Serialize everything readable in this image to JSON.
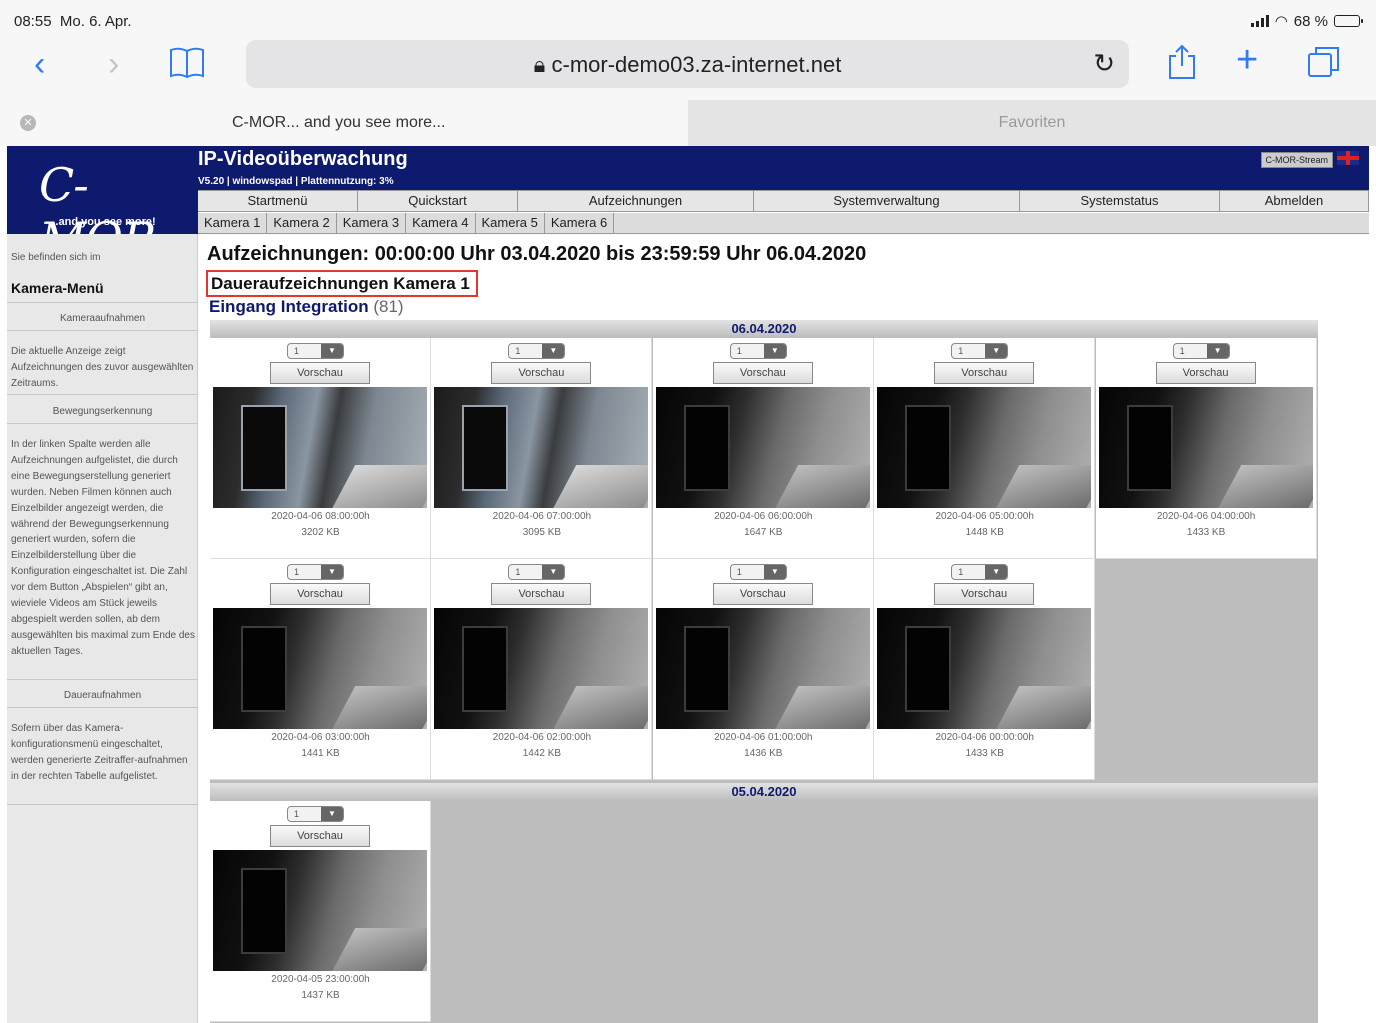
{
  "status": {
    "time": "08:55",
    "date": "Mo. 6. Apr.",
    "battery": "68 %",
    "battery_level": 0.68
  },
  "browser": {
    "url": "c-mor-demo03.za-internet.net",
    "tab_active": "C-MOR... and you see more...",
    "tab_favorites": "Favoriten"
  },
  "logo": {
    "name": "C-MOR",
    "tagline": "...and you see more!"
  },
  "header": {
    "title": "IP-Videoüberwachung",
    "version": "V5.20 | windowspad | Plattennutzung: 3%",
    "stream_button": "C-MOR-Stream"
  },
  "nav": {
    "main": [
      "Startmenü",
      "Quickstart",
      "Aufzeichnungen",
      "Systemverwaltung",
      "Systemstatus",
      "Abmelden"
    ],
    "cameras": [
      "Kamera 1",
      "Kamera 2",
      "Kamera 3",
      "Kamera 4",
      "Kamera 5",
      "Kamera 6"
    ]
  },
  "sidebar": {
    "location": "Sie befinden sich im",
    "menu_title": "Kamera-Menü",
    "sections": [
      {
        "title": "Kameraaufnahmen",
        "text": "Die aktuelle Anzeige zeigt Aufzeichnungen des zuvor ausgewählten Zeitraums."
      },
      {
        "title": "Bewegungserkennung",
        "text": "In der linken Spalte werden alle Aufzeichnungen aufgelistet, die durch eine Bewegungserstellung generiert wurden. Neben Filmen können auch Einzelbilder angezeigt werden, die während der Bewegungserkennung generiert wurden, sofern die Einzelbilderstellung über die Konfiguration eingeschaltet ist. Die Zahl vor dem Button „Abspielen“ gibt an, wieviele Videos am Stück jeweils abgespielt werden sollen, ab dem ausgewählten bis maximal zum Ende des aktuellen Tages."
      },
      {
        "title": "Daueraufnahmen",
        "text": "Sofern über das Kamera-konfigurationsmenü eingeschaltet, werden generierte Zeitraffer-aufnahmen in der rechten Tabelle aufgelistet."
      }
    ]
  },
  "main": {
    "title": "Aufzeichnungen: 00:00:00 Uhr 03.04.2020 bis 23:59:59 Uhr 06.04.2020",
    "subhead": "Daueraufzeichnungen Kamera 1",
    "entrance_label": "Eingang Integration",
    "entrance_count": "(81)",
    "preview_label": "Vorschau",
    "select_value": "1",
    "days": [
      {
        "date": "06.04.2020",
        "items": [
          {
            "timestamp": "2020-04-06 08:00:00h",
            "size": "3202 KB",
            "style": "color"
          },
          {
            "timestamp": "2020-04-06 07:00:00h",
            "size": "3095 KB",
            "style": "color"
          },
          {
            "timestamp": "2020-04-06 06:00:00h",
            "size": "1647 KB",
            "style": "gray"
          },
          {
            "timestamp": "2020-04-06 05:00:00h",
            "size": "1448 KB",
            "style": "gray"
          },
          {
            "timestamp": "2020-04-06 04:00:00h",
            "size": "1433 KB",
            "style": "gray"
          },
          {
            "timestamp": "2020-04-06 03:00:00h",
            "size": "1441 KB",
            "style": "gray"
          },
          {
            "timestamp": "2020-04-06 02:00:00h",
            "size": "1442 KB",
            "style": "gray"
          },
          {
            "timestamp": "2020-04-06 01:00:00h",
            "size": "1436 KB",
            "style": "gray"
          },
          {
            "timestamp": "2020-04-06 00:00:00h",
            "size": "1433 KB",
            "style": "gray"
          }
        ]
      },
      {
        "date": "05.04.2020",
        "items": [
          {
            "timestamp": "2020-04-05 23:00:00h",
            "size": "1437 KB",
            "style": "gray"
          }
        ]
      }
    ]
  }
}
